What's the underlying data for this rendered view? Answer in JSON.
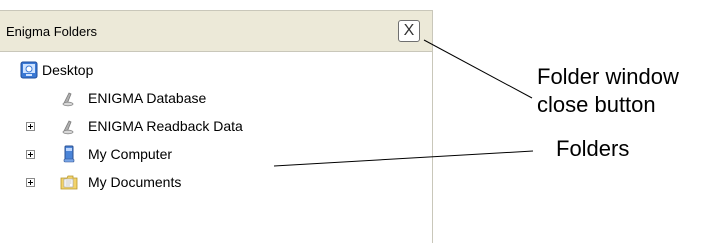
{
  "panel": {
    "title": "Enigma Folders",
    "close_glyph": "X",
    "close_icon": "close-icon"
  },
  "tree": {
    "items": [
      {
        "label": "Desktop",
        "icon": "desktop-icon",
        "expandable": false
      },
      {
        "label": "ENIGMA Database",
        "icon": "database-icon",
        "expandable": false
      },
      {
        "label": "ENIGMA Readback Data",
        "icon": "database-icon",
        "expandable": true
      },
      {
        "label": "My Computer",
        "icon": "computer-icon",
        "expandable": true
      },
      {
        "label": "My Documents",
        "icon": "documents-folder-icon",
        "expandable": true
      }
    ]
  },
  "annotations": {
    "close_button_line1": "Folder window",
    "close_button_line2": "close button",
    "folders": "Folders"
  },
  "colors": {
    "header_bg": "#ece9d8",
    "border": "#c9c7ba"
  }
}
